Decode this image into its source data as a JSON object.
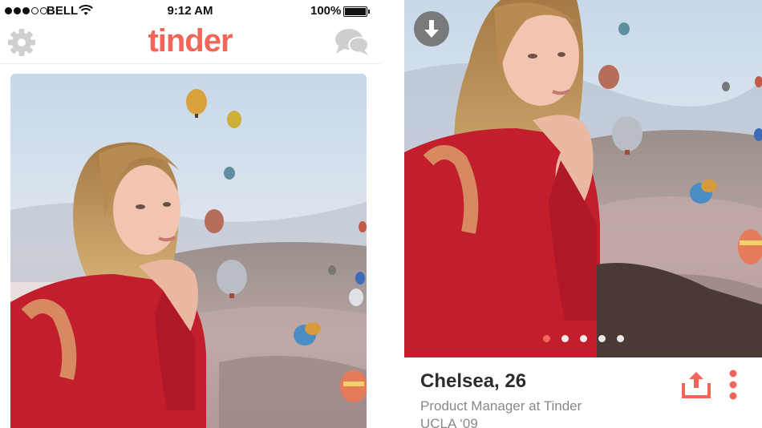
{
  "status_bar": {
    "carrier": "BELL",
    "time": "9:12 AM",
    "battery": "100%",
    "signal_bars_filled": 3,
    "signal_bars_total": 5
  },
  "header": {
    "logo_text": "tinder",
    "settings_icon": "gear-icon",
    "messages_icon": "chat-bubbles-icon"
  },
  "profile": {
    "name_age": "Chelsea, 26",
    "job": "Product Manager at Tinder",
    "school": "UCLA ‘09"
  },
  "photo_pager": {
    "count": 5,
    "active_index": 0
  },
  "actions": {
    "back_icon": "arrow-down-icon",
    "share_icon": "share-icon",
    "more_icon": "more-vertical-icon"
  },
  "colors": {
    "brand": "#f2665a",
    "text_dark": "#2c2c2c",
    "text_muted": "#888888"
  }
}
